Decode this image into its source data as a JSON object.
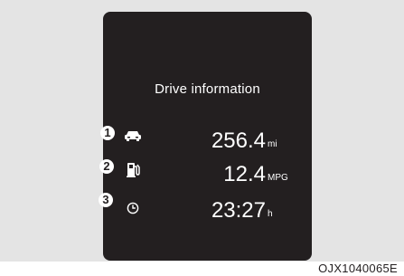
{
  "screen": {
    "title": "Drive information"
  },
  "items": [
    {
      "badge": "1",
      "icon": "car-distance-icon",
      "value": "256.4",
      "unit": "mi"
    },
    {
      "badge": "2",
      "icon": "fuel-pump-icon",
      "value": "12.4",
      "unit": "MPG"
    },
    {
      "badge": "3",
      "icon": "clock-icon",
      "value": "23:27",
      "unit": "h"
    }
  ],
  "figure_code": "OJX1040065E"
}
